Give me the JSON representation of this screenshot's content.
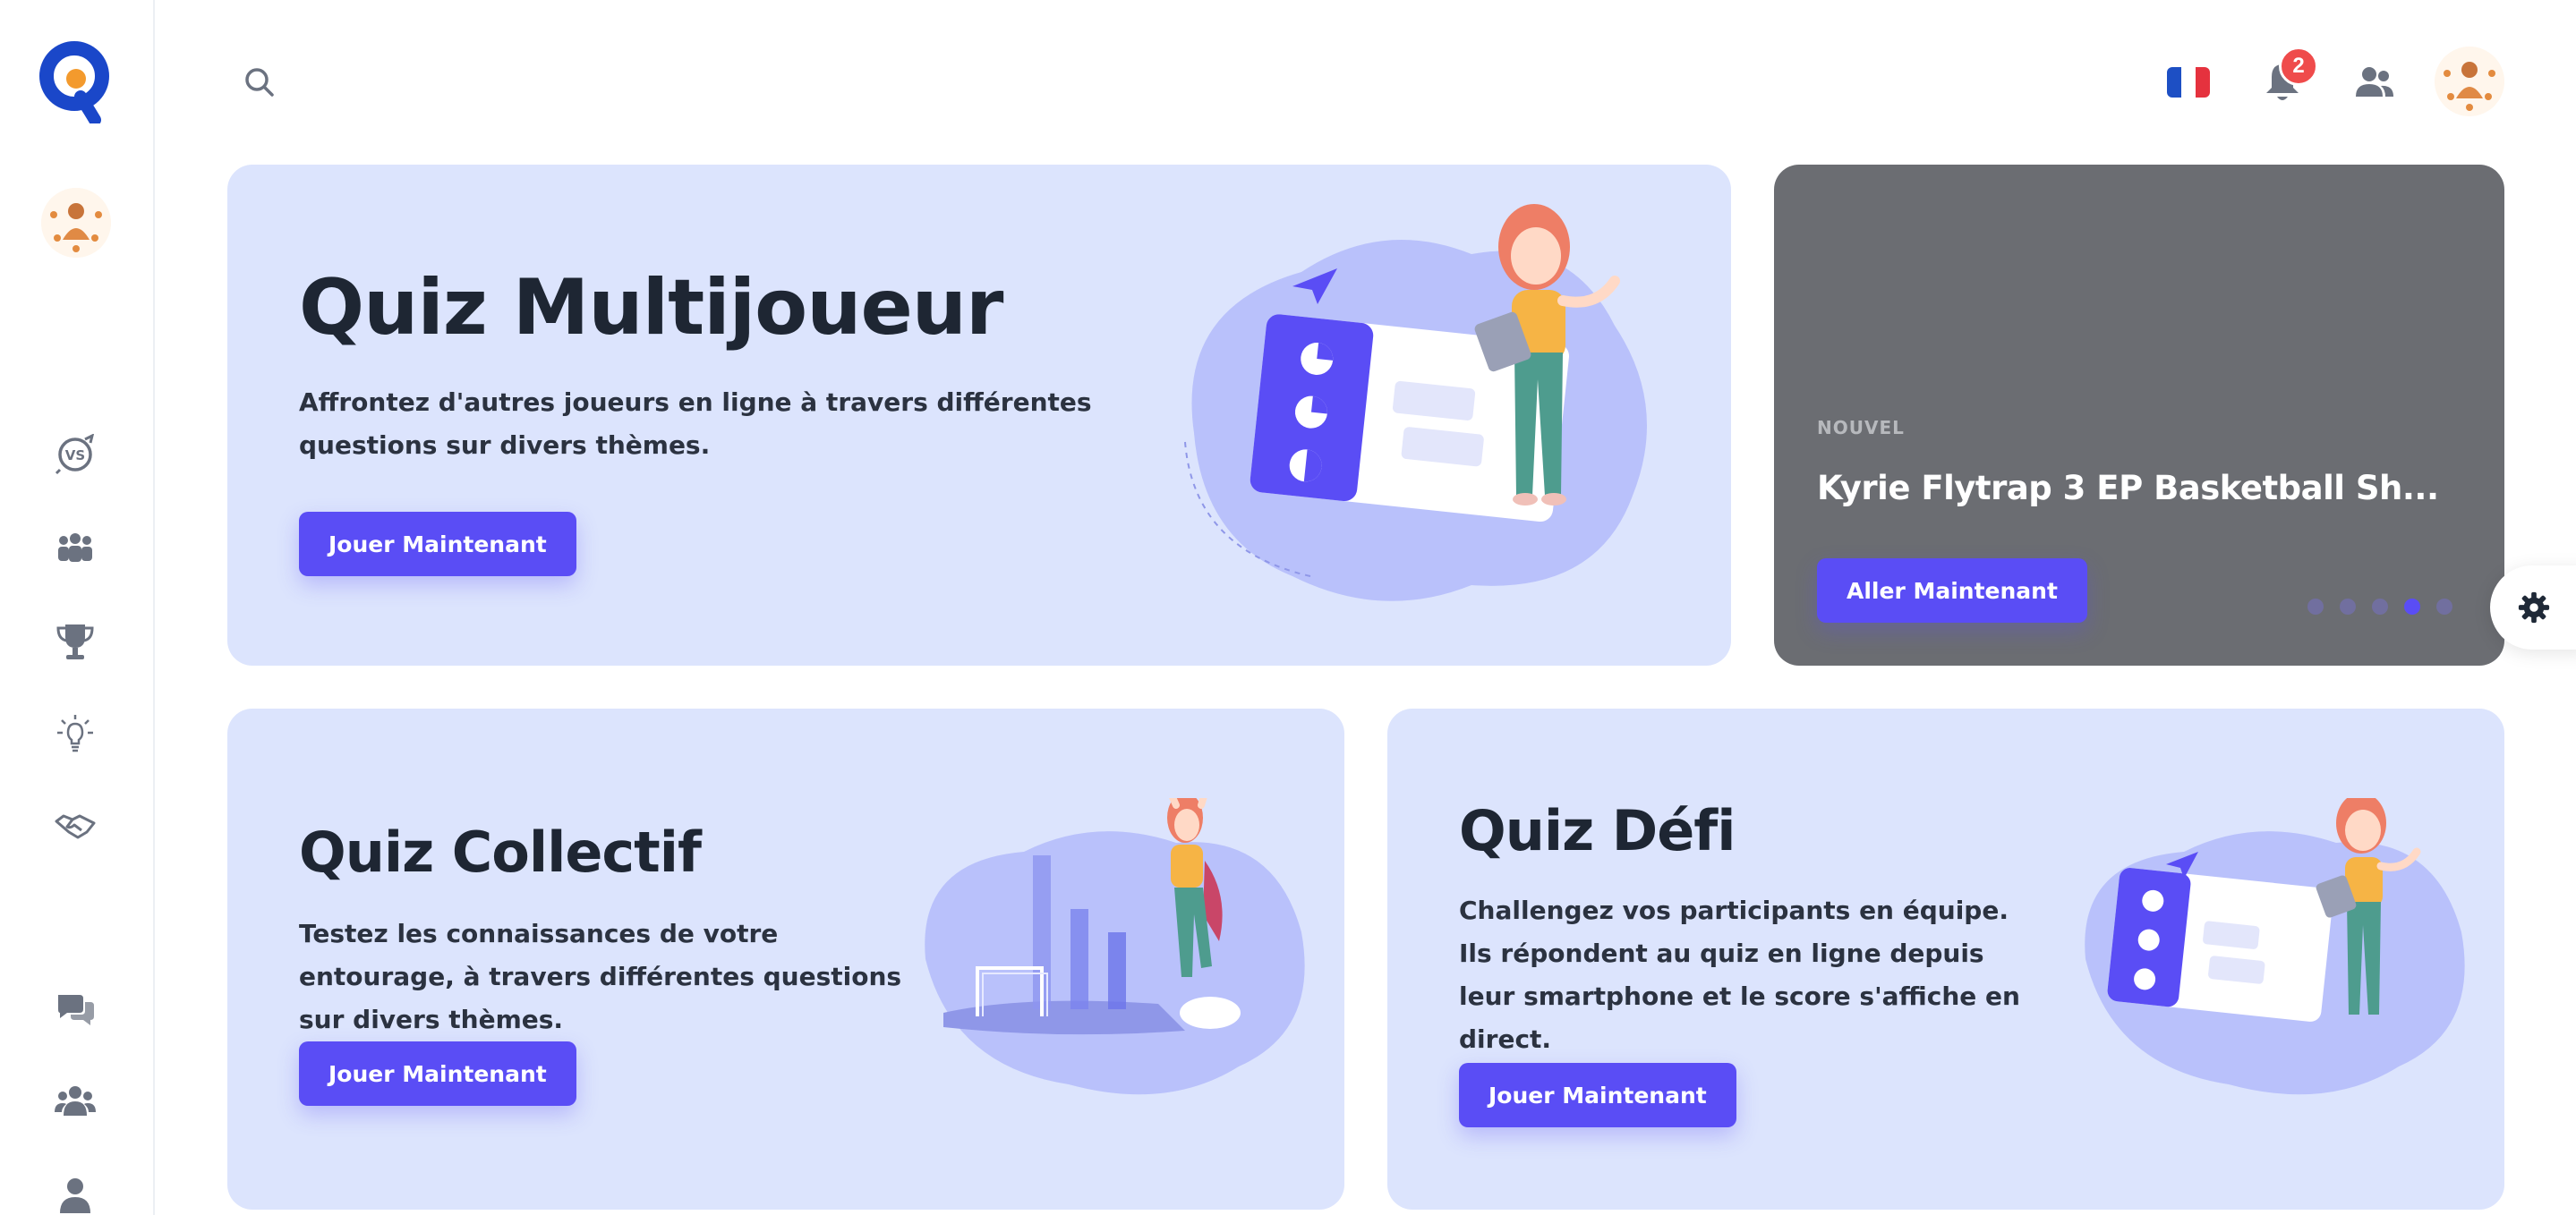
{
  "sidebar": {
    "logo": "quiz-logo",
    "nav": [
      {
        "name": "versus-icon"
      },
      {
        "name": "teams-icon"
      },
      {
        "name": "trophy-icon"
      },
      {
        "name": "brain-icon"
      },
      {
        "name": "handshake-icon"
      },
      {
        "name": "chat-icon"
      },
      {
        "name": "community-icon"
      },
      {
        "name": "profile-icon"
      }
    ]
  },
  "header": {
    "language": "fr",
    "notifications_count": "2"
  },
  "cards": {
    "multiplayer": {
      "title": "Quiz Multijoueur",
      "description": "Affrontez d'autres joueurs en ligne à travers différentes questions sur divers thèmes.",
      "button": "Jouer Maintenant"
    },
    "promo": {
      "tag": "NOUVEL",
      "title": "Kyrie Flytrap 3 EP Basketball Sh...",
      "button": "Aller Maintenant",
      "slides": 5,
      "active_slide": 4
    },
    "collectif": {
      "title": "Quiz Collectif",
      "description": "Testez les connaissances de votre entourage, à travers différentes questions sur divers thèmes.",
      "button": "Jouer Maintenant"
    },
    "defi": {
      "title": "Quiz Défi",
      "description": "Challengez vos participants en équipe. Ils répondent au quiz en ligne depuis leur smartphone et le score s'affiche en direct.",
      "button": "Jouer Maintenant"
    }
  },
  "colors": {
    "accent": "#5a4df5",
    "card_bg": "#dce4fd",
    "promo_bg": "#6b6d72",
    "badge": "#ef4b4b",
    "logo_blue": "#1a47c9",
    "logo_orange": "#f39a2d"
  }
}
